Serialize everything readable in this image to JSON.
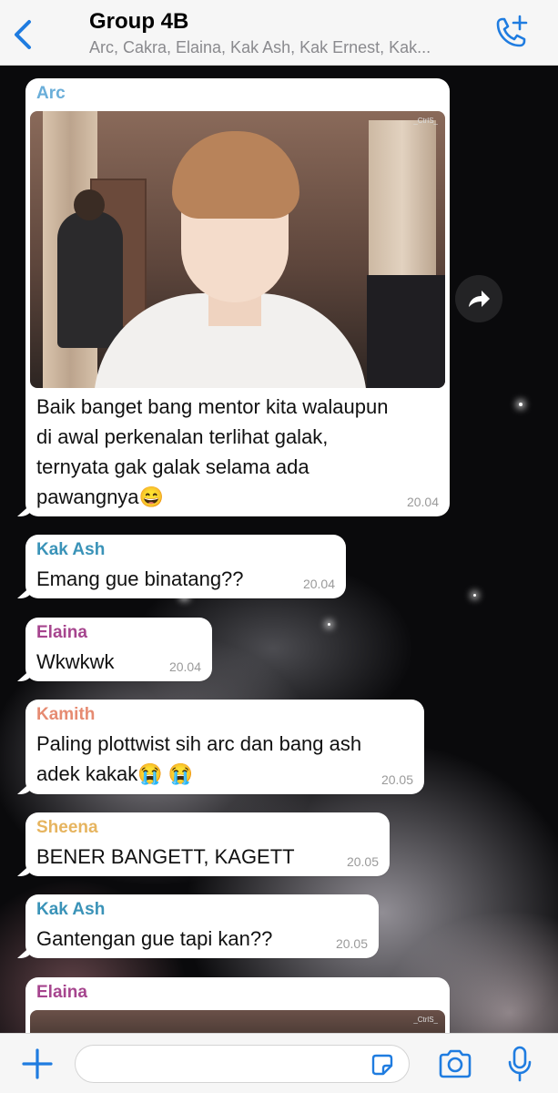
{
  "header": {
    "title": "Group 4B",
    "subtitle": "Arc, Cakra, Elaina, Kak Ash, Kak Ernest, Kak..."
  },
  "messages": [
    {
      "sender": "Arc",
      "sender_color": "#6aaed9",
      "image_watermark": "_CtrlS_",
      "text_lines": [
        "Baik banget bang mentor kita walaupun",
        "di awal perkenalan terlihat galak,",
        "ternyata gak galak selama ada",
        "pawangnya😄"
      ],
      "time": "20.04"
    },
    {
      "sender": "Kak Ash",
      "sender_color": "#3a93b8",
      "text": "Emang gue binatang??",
      "time": "20.04"
    },
    {
      "sender": "Elaina",
      "sender_color": "#a6458e",
      "text": "Wkwkwk",
      "time": "20.04"
    },
    {
      "sender": "Kamith",
      "sender_color": "#e68b72",
      "text_lines": [
        "Paling plottwist sih arc dan bang ash",
        "adek kakak😭 😭"
      ],
      "time": "20.05"
    },
    {
      "sender": "Sheena",
      "sender_color": "#e6b45f",
      "text": "BENER BANGETT, KAGETT",
      "time": "20.05"
    },
    {
      "sender": "Kak Ash",
      "sender_color": "#3a93b8",
      "text": "Gantengan gue tapi kan??",
      "time": "20.05"
    },
    {
      "sender": "Elaina",
      "sender_color": "#a6458e",
      "image_watermark": "_CtrlS_"
    }
  ],
  "icons": {
    "back": "chevron-left-icon",
    "call": "add-call-icon",
    "forward": "forward-arrow-icon",
    "attach": "plus-icon",
    "sticker": "sticker-icon",
    "camera": "camera-icon",
    "mic": "microphone-icon"
  },
  "accent_color": "#1f7ce0"
}
